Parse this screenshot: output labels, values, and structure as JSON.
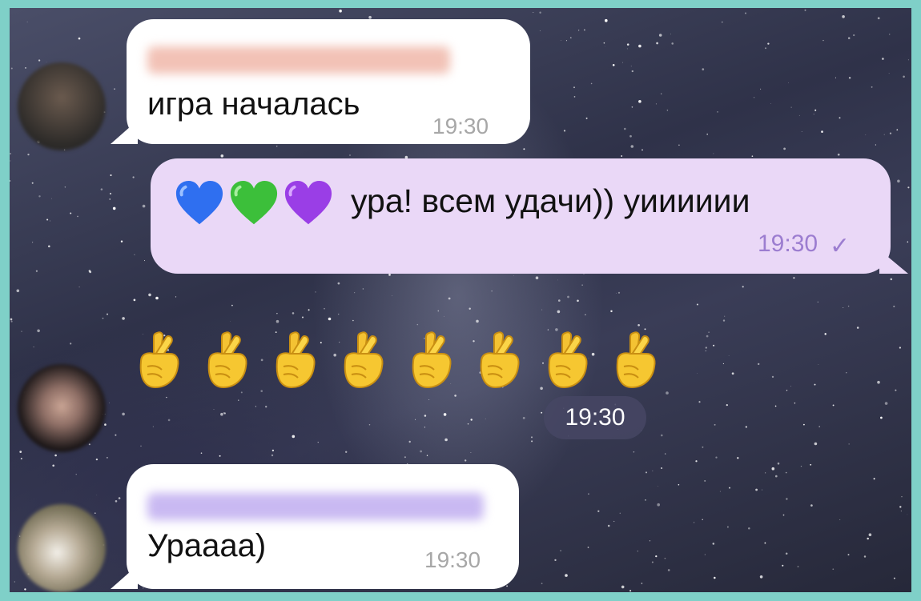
{
  "messages": [
    {
      "id": "m1",
      "text": "игра началась",
      "time": "19:30"
    },
    {
      "id": "m2",
      "text": "ура! всем удачи)) уииииии",
      "time": "19:30",
      "emoji": [
        "blue-heart",
        "green-heart",
        "purple-heart"
      ],
      "status": "sent-check"
    },
    {
      "id": "m3",
      "emoji_count": 8,
      "emoji": "crossed-fingers",
      "time": "19:30"
    },
    {
      "id": "m4",
      "text": "Ураааа)",
      "time": "19:30"
    }
  ],
  "colors": {
    "incoming_bubble": "#ffffff",
    "outgoing_bubble": "#ead8f7",
    "outgoing_time": "#9c7dd0",
    "frame": "#7fd0c8"
  },
  "ui": {
    "check_mark": "✓"
  }
}
